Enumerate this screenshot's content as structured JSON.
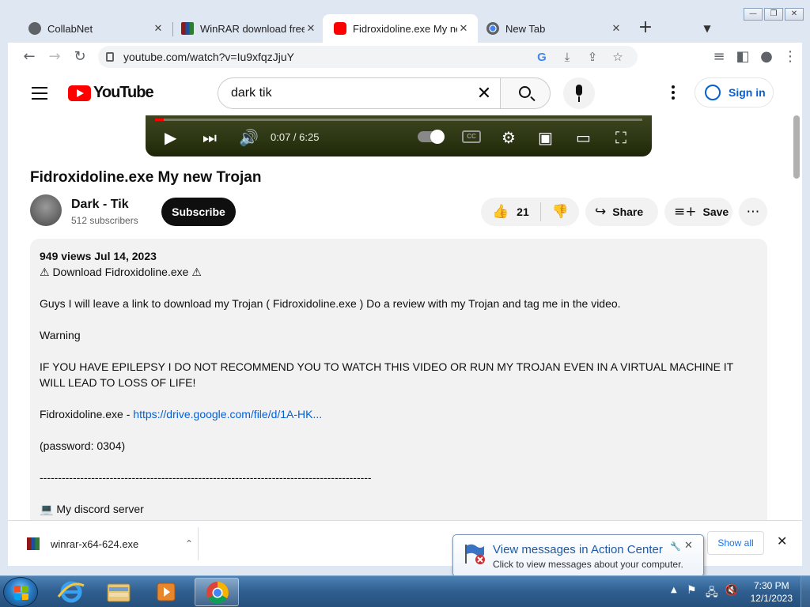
{
  "browser": {
    "tabs": [
      {
        "title": "CollabNet",
        "icon": "globe-icon"
      },
      {
        "title": "WinRAR download free",
        "icon": "winrar-icon"
      },
      {
        "title": "Fidroxidoline.exe My ne",
        "icon": "youtube-icon",
        "active": true
      },
      {
        "title": "New Tab",
        "icon": "chrome-icon"
      }
    ],
    "new_tab_glyph": "+",
    "url": "youtube.com/watch?v=Iu9xfqzJjuY"
  },
  "youtube": {
    "logo_text": "YouTube",
    "search_value": "dark tik",
    "sign_in": "Sign in",
    "player": {
      "time": "0:07 / 6:25",
      "progress_fraction": 0.018
    },
    "video_title": "Fidroxidoline.exe My new Trojan",
    "channel_name": "Dark - Tik",
    "subscribers": "512 subscribers",
    "subscribe_label": "Subscribe",
    "likes": "21",
    "share_label": "Share",
    "save_label": "Save",
    "description": {
      "meta": "949 views  Jul 14, 2023",
      "lines": [
        "⚠ Download Fidroxidoline.exe ⚠",
        "",
        "Guys I will leave a link to download my Trojan ( Fidroxidoline.exe ) Do a review with my Trojan and tag me in the video.",
        "",
        "Warning",
        "",
        "IF YOU HAVE EPILEPSY I DO NOT RECOMMEND YOU TO WATCH THIS VIDEO OR RUN MY TROJAN EVEN IN A VIRTUAL MACHINE IT WILL LEAD TO LOSS OF LIFE!",
        ""
      ],
      "link_prefix": "Fidroxidoline.exe - ",
      "link_text": "https://drive.google.com/file/d/1A-HK...",
      "after_link": [
        "",
        "(password: 0304)",
        "",
        "------------------------------------------------------------------------------------------",
        "",
        "💻 My discord server"
      ]
    }
  },
  "downloads": {
    "file": "winrar-x64-624.exe",
    "show_all": "Show all"
  },
  "balloon": {
    "title": "View messages in Action Center",
    "subtitle": "Click to view messages about your computer."
  },
  "taskbar": {
    "time": "7:30 PM",
    "date": "12/1/2023"
  },
  "colors": {
    "youtube_red": "#ff0000",
    "link_blue": "#065fd4",
    "taskbar": "#2f5e8f"
  }
}
